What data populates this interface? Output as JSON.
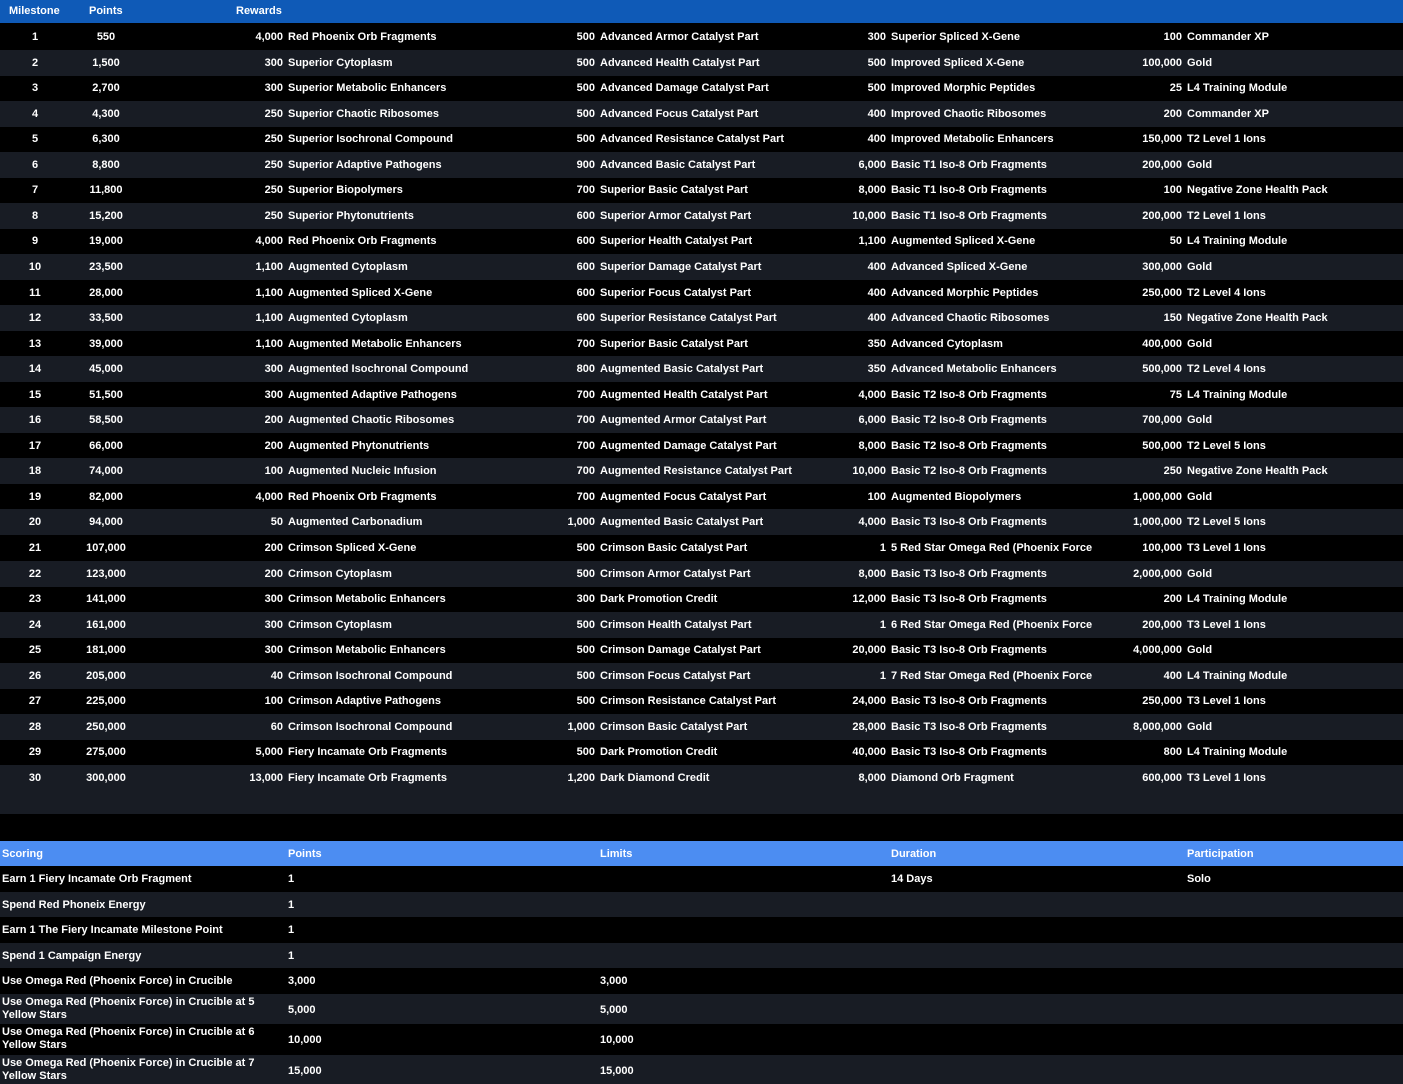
{
  "milestones_header": {
    "milestone": "Milestone",
    "points": "Points",
    "rewards": "Rewards"
  },
  "milestones": [
    {
      "m": "1",
      "p": "550",
      "r": [
        [
          "4,000",
          "Red Phoenix Orb Fragments"
        ],
        [
          "500",
          "Advanced Armor Catalyst Part"
        ],
        [
          "300",
          "Superior Spliced X-Gene"
        ],
        [
          "100",
          "Commander XP"
        ]
      ]
    },
    {
      "m": "2",
      "p": "1,500",
      "r": [
        [
          "300",
          "Superior Cytoplasm"
        ],
        [
          "500",
          "Advanced Health Catalyst Part"
        ],
        [
          "500",
          "Improved Spliced X-Gene"
        ],
        [
          "100,000",
          "Gold"
        ]
      ]
    },
    {
      "m": "3",
      "p": "2,700",
      "r": [
        [
          "300",
          "Superior Metabolic Enhancers"
        ],
        [
          "500",
          "Advanced Damage Catalyst Part"
        ],
        [
          "500",
          "Improved Morphic Peptides"
        ],
        [
          "25",
          "L4 Training Module"
        ]
      ]
    },
    {
      "m": "4",
      "p": "4,300",
      "r": [
        [
          "250",
          "Superior Chaotic Ribosomes"
        ],
        [
          "500",
          "Advanced Focus Catalyst Part"
        ],
        [
          "400",
          "Improved Chaotic Ribosomes"
        ],
        [
          "200",
          "Commander XP"
        ]
      ]
    },
    {
      "m": "5",
      "p": "6,300",
      "r": [
        [
          "250",
          "Superior Isochronal Compound"
        ],
        [
          "500",
          "Advanced Resistance Catalyst Part"
        ],
        [
          "400",
          "Improved Metabolic Enhancers"
        ],
        [
          "150,000",
          "T2 Level 1 Ions"
        ]
      ]
    },
    {
      "m": "6",
      "p": "8,800",
      "r": [
        [
          "250",
          "Superior Adaptive Pathogens"
        ],
        [
          "900",
          "Advanced Basic Catalyst Part"
        ],
        [
          "6,000",
          "Basic T1 Iso-8 Orb Fragments"
        ],
        [
          "200,000",
          "Gold"
        ]
      ]
    },
    {
      "m": "7",
      "p": "11,800",
      "r": [
        [
          "250",
          "Superior Biopolymers"
        ],
        [
          "700",
          "Superior Basic Catalyst Part"
        ],
        [
          "8,000",
          "Basic T1 Iso-8 Orb Fragments"
        ],
        [
          "100",
          "Negative Zone Health Pack"
        ]
      ]
    },
    {
      "m": "8",
      "p": "15,200",
      "r": [
        [
          "250",
          "Superior Phytonutrients"
        ],
        [
          "600",
          "Superior Armor Catalyst Part"
        ],
        [
          "10,000",
          "Basic T1 Iso-8 Orb Fragments"
        ],
        [
          "200,000",
          "T2 Level 1 Ions"
        ]
      ]
    },
    {
      "m": "9",
      "p": "19,000",
      "r": [
        [
          "4,000",
          "Red Phoenix Orb Fragments"
        ],
        [
          "600",
          "Superior Health Catalyst Part"
        ],
        [
          "1,100",
          "Augmented Spliced X-Gene"
        ],
        [
          "50",
          "L4 Training Module"
        ]
      ]
    },
    {
      "m": "10",
      "p": "23,500",
      "r": [
        [
          "1,100",
          "Augmented Cytoplasm"
        ],
        [
          "600",
          "Superior Damage Catalyst Part"
        ],
        [
          "400",
          "Advanced Spliced X-Gene"
        ],
        [
          "300,000",
          "Gold"
        ]
      ]
    },
    {
      "m": "11",
      "p": "28,000",
      "r": [
        [
          "1,100",
          "Augmented Spliced X-Gene"
        ],
        [
          "600",
          "Superior Focus Catalyst Part"
        ],
        [
          "400",
          "Advanced Morphic Peptides"
        ],
        [
          "250,000",
          "T2 Level 4 Ions"
        ]
      ]
    },
    {
      "m": "12",
      "p": "33,500",
      "r": [
        [
          "1,100",
          "Augmented Cytoplasm"
        ],
        [
          "600",
          "Superior Resistance Catalyst Part"
        ],
        [
          "400",
          "Advanced Chaotic Ribosomes"
        ],
        [
          "150",
          "Negative Zone Health Pack"
        ]
      ]
    },
    {
      "m": "13",
      "p": "39,000",
      "r": [
        [
          "1,100",
          "Augmented Metabolic Enhancers"
        ],
        [
          "700",
          "Superior Basic Catalyst Part"
        ],
        [
          "350",
          "Advanced Cytoplasm"
        ],
        [
          "400,000",
          "Gold"
        ]
      ]
    },
    {
      "m": "14",
      "p": "45,000",
      "r": [
        [
          "300",
          "Augmented Isochronal Compound"
        ],
        [
          "800",
          "Augmented Basic Catalyst Part"
        ],
        [
          "350",
          "Advanced Metabolic Enhancers"
        ],
        [
          "500,000",
          "T2 Level 4 Ions"
        ]
      ]
    },
    {
      "m": "15",
      "p": "51,500",
      "r": [
        [
          "300",
          "Augmented Adaptive Pathogens"
        ],
        [
          "700",
          "Augmented Health Catalyst Part"
        ],
        [
          "4,000",
          "Basic T2 Iso-8 Orb Fragments"
        ],
        [
          "75",
          "L4 Training Module"
        ]
      ]
    },
    {
      "m": "16",
      "p": "58,500",
      "r": [
        [
          "200",
          "Augmented Chaotic Ribosomes"
        ],
        [
          "700",
          "Augmented Armor Catalyst Part"
        ],
        [
          "6,000",
          "Basic T2 Iso-8 Orb Fragments"
        ],
        [
          "700,000",
          "Gold"
        ]
      ]
    },
    {
      "m": "17",
      "p": "66,000",
      "r": [
        [
          "200",
          "Augmented Phytonutrients"
        ],
        [
          "700",
          "Augmented Damage Catalyst Part"
        ],
        [
          "8,000",
          "Basic T2 Iso-8 Orb Fragments"
        ],
        [
          "500,000",
          "T2 Level 5 Ions"
        ]
      ]
    },
    {
      "m": "18",
      "p": "74,000",
      "r": [
        [
          "100",
          "Augmented Nucleic Infusion"
        ],
        [
          "700",
          "Augmented Resistance Catalyst Part"
        ],
        [
          "10,000",
          "Basic T2 Iso-8 Orb Fragments"
        ],
        [
          "250",
          "Negative Zone Health Pack"
        ]
      ]
    },
    {
      "m": "19",
      "p": "82,000",
      "r": [
        [
          "4,000",
          "Red Phoenix Orb Fragments"
        ],
        [
          "700",
          "Augmented Focus Catalyst Part"
        ],
        [
          "100",
          "Augmented Biopolymers"
        ],
        [
          "1,000,000",
          "Gold"
        ]
      ]
    },
    {
      "m": "20",
      "p": "94,000",
      "r": [
        [
          "50",
          "Augmented Carbonadium"
        ],
        [
          "1,000",
          "Augmented Basic Catalyst Part"
        ],
        [
          "4,000",
          "Basic T3 Iso-8 Orb Fragments"
        ],
        [
          "1,000,000",
          "T2 Level 5 Ions"
        ]
      ]
    },
    {
      "m": "21",
      "p": "107,000",
      "r": [
        [
          "200",
          "Crimson Spliced X-Gene"
        ],
        [
          "500",
          "Crimson Basic Catalyst Part"
        ],
        [
          "1",
          "5 Red Star Omega Red (Phoenix Force"
        ],
        [
          "100,000",
          "T3 Level 1 Ions"
        ]
      ]
    },
    {
      "m": "22",
      "p": "123,000",
      "r": [
        [
          "200",
          "Crimson Cytoplasm"
        ],
        [
          "500",
          "Crimson Armor Catalyst Part"
        ],
        [
          "8,000",
          "Basic T3 Iso-8 Orb Fragments"
        ],
        [
          "2,000,000",
          "Gold"
        ]
      ]
    },
    {
      "m": "23",
      "p": "141,000",
      "r": [
        [
          "300",
          "Crimson Metabolic Enhancers"
        ],
        [
          "300",
          "Dark Promotion Credit"
        ],
        [
          "12,000",
          "Basic T3 Iso-8 Orb Fragments"
        ],
        [
          "200",
          "L4 Training Module"
        ]
      ]
    },
    {
      "m": "24",
      "p": "161,000",
      "r": [
        [
          "300",
          "Crimson Cytoplasm"
        ],
        [
          "500",
          "Crimson Health Catalyst Part"
        ],
        [
          "1",
          "6 Red Star Omega Red (Phoenix Force"
        ],
        [
          "200,000",
          "T3 Level 1 Ions"
        ]
      ]
    },
    {
      "m": "25",
      "p": "181,000",
      "r": [
        [
          "300",
          "Crimson Metabolic Enhancers"
        ],
        [
          "500",
          "Crimson Damage Catalyst Part"
        ],
        [
          "20,000",
          "Basic T3 Iso-8 Orb Fragments"
        ],
        [
          "4,000,000",
          "Gold"
        ]
      ]
    },
    {
      "m": "26",
      "p": "205,000",
      "r": [
        [
          "40",
          "Crimson Isochronal Compound"
        ],
        [
          "500",
          "Crimson Focus Catalyst Part"
        ],
        [
          "1",
          "7 Red Star Omega Red (Phoenix Force"
        ],
        [
          "400",
          "L4 Training Module"
        ]
      ]
    },
    {
      "m": "27",
      "p": "225,000",
      "r": [
        [
          "100",
          "Crimson Adaptive Pathogens"
        ],
        [
          "500",
          "Crimson Resistance Catalyst Part"
        ],
        [
          "24,000",
          "Basic T3 Iso-8 Orb Fragments"
        ],
        [
          "250,000",
          "T3 Level 1 Ions"
        ]
      ]
    },
    {
      "m": "28",
      "p": "250,000",
      "r": [
        [
          "60",
          "Crimson Isochronal Compound"
        ],
        [
          "1,000",
          "Crimson Basic Catalyst Part"
        ],
        [
          "28,000",
          "Basic T3 Iso-8 Orb Fragments"
        ],
        [
          "8,000,000",
          "Gold"
        ]
      ]
    },
    {
      "m": "29",
      "p": "275,000",
      "r": [
        [
          "5,000",
          "Fiery Incamate Orb Fragments"
        ],
        [
          "500",
          "Dark Promotion Credit"
        ],
        [
          "40,000",
          "Basic T3 Iso-8 Orb Fragments"
        ],
        [
          "800",
          "L4 Training Module"
        ]
      ]
    },
    {
      "m": "30",
      "p": "300,000",
      "r": [
        [
          "13,000",
          "Fiery Incamate Orb Fragments"
        ],
        [
          "1,200",
          "Dark Diamond Credit"
        ],
        [
          "8,000",
          "Diamond Orb Fragment"
        ],
        [
          "600,000",
          "T3 Level 1 Ions"
        ]
      ]
    }
  ],
  "scoring_header": {
    "scoring": "Scoring",
    "points": "Points",
    "limits": "Limits",
    "duration": "Duration",
    "participation": "Participation"
  },
  "scoring": [
    {
      "action": "Earn 1 Fiery Incamate Orb Fragment",
      "points": "1",
      "limit": "",
      "duration": "14 Days",
      "participation": "Solo"
    },
    {
      "action": "Spend Red Phoneix Energy",
      "points": "1",
      "limit": "",
      "duration": "",
      "participation": ""
    },
    {
      "action": "Earn 1 The Fiery Incamate Milestone Point",
      "points": "1",
      "limit": "",
      "duration": "",
      "participation": ""
    },
    {
      "action": "Spend 1 Campaign Energy",
      "points": "1",
      "limit": "",
      "duration": "",
      "participation": ""
    },
    {
      "action": "Use Omega Red (Phoenix Force) in Crucible",
      "points": "3,000",
      "limit": "3,000",
      "duration": "",
      "participation": ""
    },
    {
      "action": "Use Omega Red (Phoenix Force) in Crucible at 5 Yellow Stars",
      "points": "5,000",
      "limit": "5,000",
      "duration": "",
      "participation": ""
    },
    {
      "action": "Use Omega Red (Phoenix Force) in Crucible at 6 Yellow Stars",
      "points": "10,000",
      "limit": "10,000",
      "duration": "",
      "participation": ""
    },
    {
      "action": "Use Omega Red (Phoenix Force) in Crucible at 7 Yellow Stars",
      "points": "15,000",
      "limit": "15,000",
      "duration": "",
      "participation": ""
    }
  ]
}
